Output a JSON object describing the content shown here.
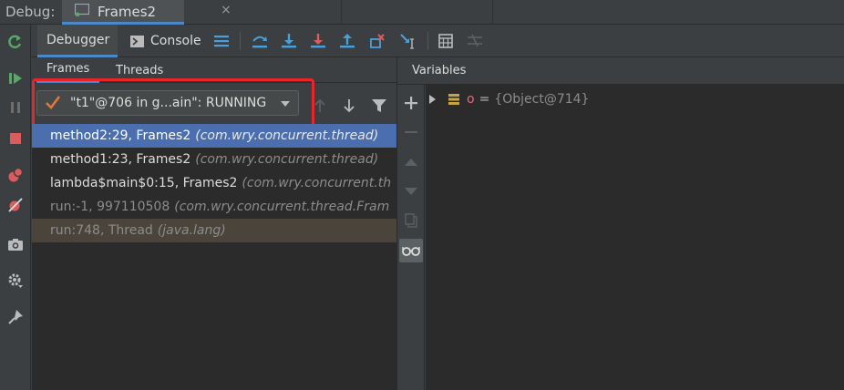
{
  "debug_bar": {
    "label": "Debug:",
    "run_tab": {
      "title": "Frames2",
      "close": "×"
    }
  },
  "toolbar": {
    "debugger_tab": "Debugger",
    "console_tab": "Console"
  },
  "frames_panel": {
    "tabs": [
      {
        "label": "Frames"
      },
      {
        "label": "Threads"
      }
    ],
    "thread_selector": {
      "value": "\"t1\"@706 in g...ain\": RUNNING"
    },
    "frames": [
      {
        "method": "method2:29, Frames2",
        "package": "(com.wry.concurrent.thread)",
        "state": "selected"
      },
      {
        "method": "method1:23, Frames2",
        "package": "(com.wry.concurrent.thread)",
        "state": "normal"
      },
      {
        "method": "lambda$main$0:15, Frames2",
        "package": "(com.wry.concurrent.th",
        "state": "normal"
      },
      {
        "method": "run:-1, 997110508",
        "package": "(com.wry.concurrent.thread.Fram",
        "state": "dim"
      },
      {
        "method": "run:748, Thread",
        "package": "(java.lang)",
        "state": "library"
      }
    ]
  },
  "variables_panel": {
    "title": "Variables",
    "items": [
      {
        "name": "o",
        "eq": "=",
        "value": "{Object@714}"
      }
    ]
  },
  "colors": {
    "accent": "#4a88c7",
    "selection": "#4b6eaf",
    "highlight_box": "#e8262a",
    "resume_green": "#59a869",
    "stop_red": "#db5c5c"
  }
}
